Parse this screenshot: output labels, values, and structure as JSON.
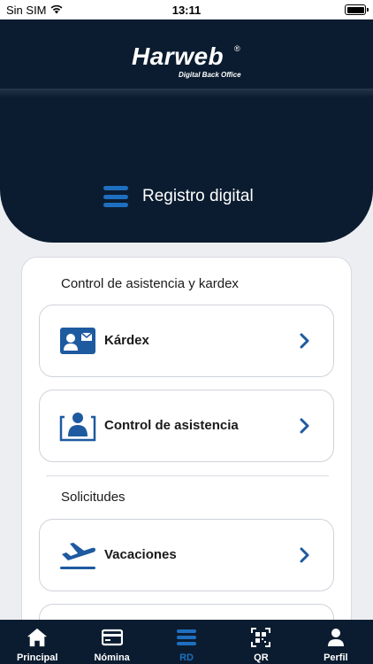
{
  "status_bar": {
    "carrier": "Sin SIM",
    "time": "13:11"
  },
  "brand": {
    "name": "Harweb",
    "registered": "®",
    "tagline": "Digital Back Office"
  },
  "section": {
    "title": "Registro digital",
    "icon": "list-icon"
  },
  "groups": [
    {
      "label": "Control de asistencia y kardex",
      "items": [
        {
          "label": "Kárdex",
          "icon": "id-card-icon"
        },
        {
          "label": "Control de asistencia",
          "icon": "attendance-user-icon"
        }
      ]
    },
    {
      "label": "Solicitudes",
      "items": [
        {
          "label": "Vacaciones",
          "icon": "airplane-departure-icon"
        }
      ]
    }
  ],
  "tabbar": {
    "active": "RD",
    "tabs": [
      {
        "label": "Principal",
        "icon": "home-icon"
      },
      {
        "label": "Nómina",
        "icon": "payment-card-icon"
      },
      {
        "label": "RD",
        "icon": "list-icon"
      },
      {
        "label": "QR",
        "icon": "qr-code-icon"
      },
      {
        "label": "Perfil",
        "icon": "user-icon"
      }
    ]
  },
  "colors": {
    "navy": "#0b1c30",
    "accent": "#1e6fbf",
    "background": "#eceef2"
  }
}
